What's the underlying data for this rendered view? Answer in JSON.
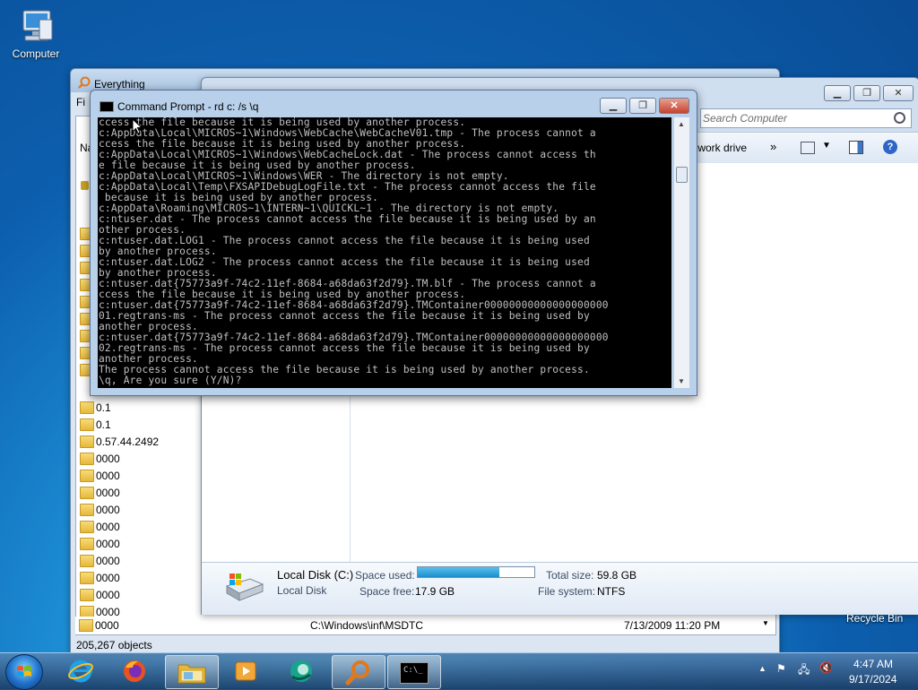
{
  "desktop": {
    "computer_label": "Computer",
    "recycle_bin_label": "Recycle Bin"
  },
  "everything": {
    "title": "Everything",
    "menu_first": "Fi",
    "name_header": "Na",
    "rows": [
      "0.1",
      "0.1",
      "0.57.44.2492",
      "0000",
      "0000",
      "0000",
      "0000",
      "0000",
      "0000",
      "0000",
      "0000",
      "0000",
      "0000",
      "0000"
    ],
    "path_row": {
      "path": "C:\\Windows\\inf\\MSDTC",
      "date": "7/13/2009 11:20 PM"
    },
    "status": "205,267 objects"
  },
  "explorer": {
    "search_placeholder": "Search Computer",
    "toolbar_network": "twork drive",
    "toolbar_more": "»",
    "details": {
      "drive_name": "Local Disk (C:)",
      "drive_type": "Local Disk",
      "space_used_label": "Space used:",
      "space_free_label": "Space free:",
      "space_free_value": "17.9 GB",
      "total_size_label": "Total size:",
      "total_size_value": "59.8 GB",
      "file_system_label": "File system:",
      "file_system_value": "NTFS",
      "used_fraction": 0.7
    }
  },
  "cmd": {
    "title": "Command Prompt - rd  c: /s \\q",
    "lines": [
      "ccess the file because it is being used by another process.",
      "c:AppData\\Local\\MICROS~1\\Windows\\WebCache\\WebCacheV01.tmp - The process cannot a",
      "ccess the file because it is being used by another process.",
      "c:AppData\\Local\\MICROS~1\\Windows\\WebCacheLock.dat - The process cannot access th",
      "e file because it is being used by another process.",
      "c:AppData\\Local\\MICROS~1\\Windows\\WER - The directory is not empty.",
      "c:AppData\\Local\\Temp\\FXSAPIDebugLogFile.txt - The process cannot access the file",
      " because it is being used by another process.",
      "c:AppData\\Roaming\\MICROS~1\\INTERN~1\\QUICKL~1 - The directory is not empty.",
      "c:ntuser.dat - The process cannot access the file because it is being used by an",
      "other process.",
      "c:ntuser.dat.LOG1 - The process cannot access the file because it is being used",
      "by another process.",
      "c:ntuser.dat.LOG2 - The process cannot access the file because it is being used",
      "by another process.",
      "c:ntuser.dat{75773a9f-74c2-11ef-8684-a68da63f2d79}.TM.blf - The process cannot a",
      "ccess the file because it is being used by another process.",
      "c:ntuser.dat{75773a9f-74c2-11ef-8684-a68da63f2d79}.TMContainer00000000000000000000",
      "01.regtrans-ms - The process cannot access the file because it is being used by",
      "another process.",
      "c:ntuser.dat{75773a9f-74c2-11ef-8684-a68da63f2d79}.TMContainer00000000000000000000",
      "02.regtrans-ms - The process cannot access the file because it is being used by",
      "another process.",
      "The process cannot access the file because it is being used by another process.",
      "\\q, Are you sure (Y/N)?"
    ]
  },
  "taskbar": {
    "time": "4:47 AM",
    "date": "9/17/2024",
    "apps": [
      "internet-explorer",
      "firefox",
      "file-explorer",
      "media-player",
      "app-green",
      "everything",
      "command-prompt"
    ]
  },
  "colors": {
    "console_bg": "#000000",
    "console_fg": "#c0c0c0",
    "close_red": "#c4432e",
    "disk_bar": "#1a8fcf"
  }
}
